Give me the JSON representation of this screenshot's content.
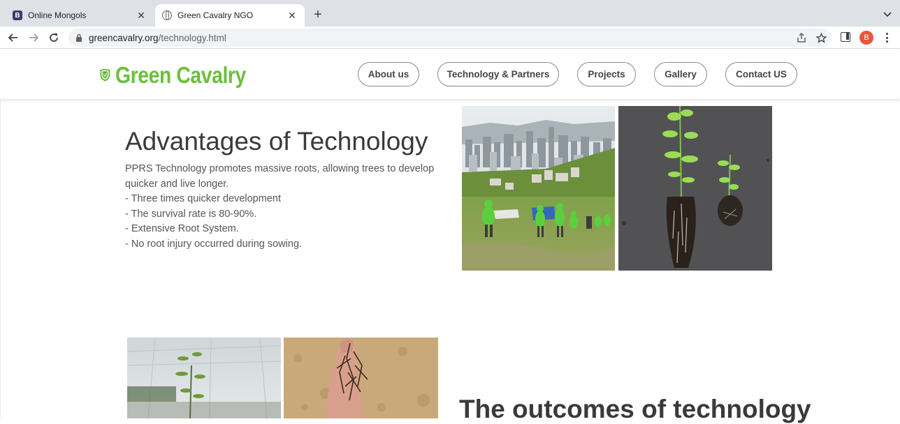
{
  "browser": {
    "tabs": [
      {
        "title": "Online Mongols",
        "favicon": "bootstrap-icon",
        "active": false
      },
      {
        "title": "Green Cavalry NGO",
        "favicon": "globe-icon",
        "active": true
      }
    ],
    "url_domain": "greencavalry.org",
    "url_path": "/technology.html",
    "profile_initial": "B",
    "accent_colors": {
      "profile": "#e8573c"
    }
  },
  "site": {
    "logo_text": "Green Cavalry",
    "brand_color": "#6cbf3d",
    "nav": [
      {
        "label": "About us"
      },
      {
        "label": "Technology & Partners"
      },
      {
        "label": "Projects"
      },
      {
        "label": "Gallery"
      },
      {
        "label": "Contact US"
      }
    ]
  },
  "advantages": {
    "heading": "Advantages of Technology",
    "intro": "PPRS Technology promotes massive roots, allowing trees to develop quicker and live longer.",
    "points": [
      "- Three times quicker development",
      "- The survival rate is 80-90%.",
      "- Extensive Root System.",
      "- No root injury occurred during sowing."
    ]
  },
  "outcomes": {
    "heading": "The outcomes of technology"
  }
}
